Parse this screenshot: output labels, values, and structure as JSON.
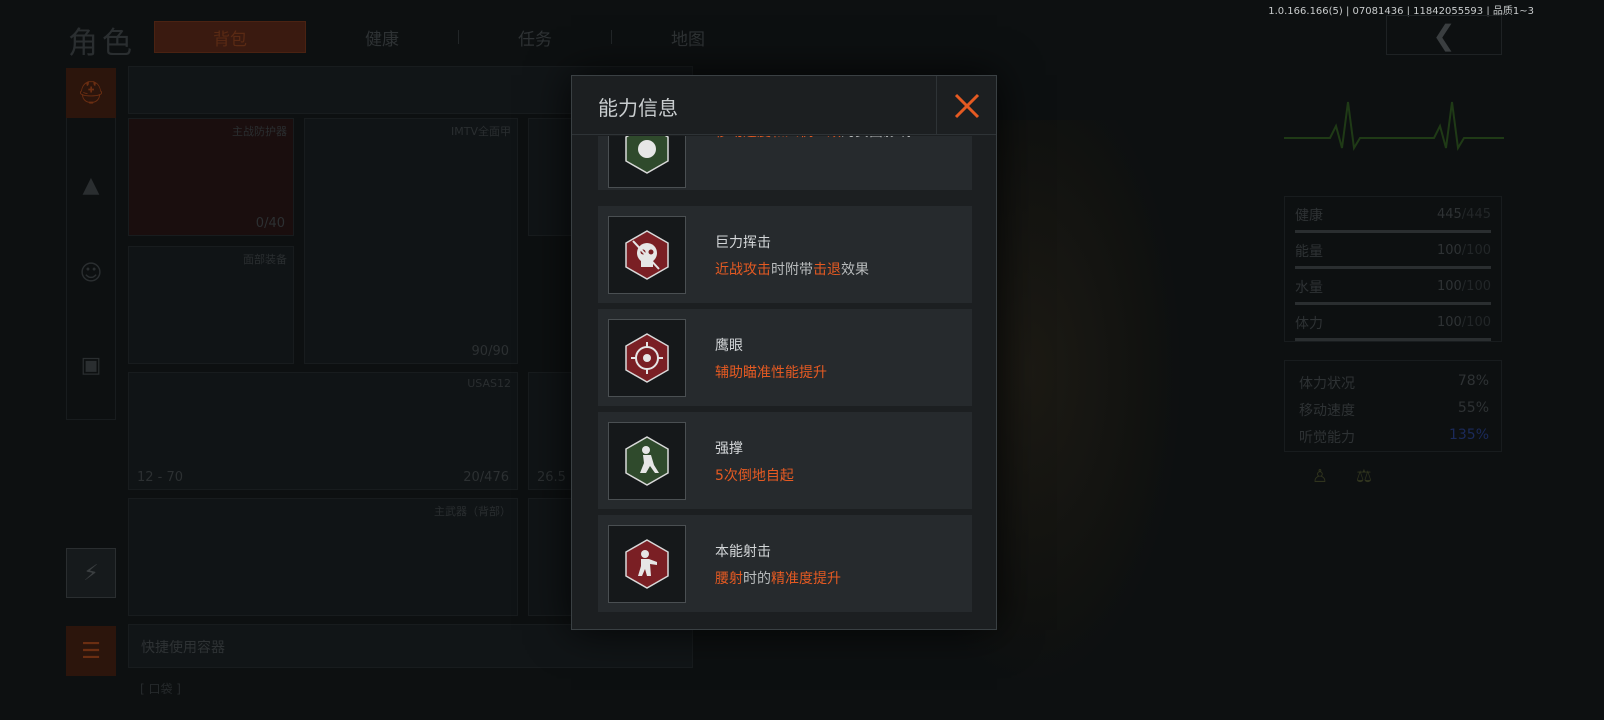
{
  "version": "1.0.166.166(5) | 07081436 | 11842055593 | 品质1~3",
  "page_title": "角色",
  "tabs": [
    {
      "label": "背包",
      "active": true
    },
    {
      "label": "健康",
      "active": false
    },
    {
      "label": "任务",
      "active": false
    },
    {
      "label": "地图",
      "active": false
    }
  ],
  "inventory": {
    "count": "4",
    "slots": {
      "armor_left_label": "主战防护器",
      "armor_left_value": "0/40",
      "vest_label": "IMTV全面甲",
      "vest_value": "90/90",
      "face_label": "面部装备",
      "gun_label": "USAS12",
      "gun_ammo": "12 - 70",
      "gun_value": "20/476",
      "slot_right_value": "26.5",
      "primary_label": "主武器（背部）"
    },
    "quick_use": "快捷使用容器",
    "pocket": "[ 口袋 ]"
  },
  "stats": [
    {
      "name": "健康",
      "value": "445",
      "max": "/445"
    },
    {
      "name": "能量",
      "value": "100",
      "max": "/100"
    },
    {
      "name": "水量",
      "value": "100",
      "max": "/100"
    },
    {
      "name": "体力",
      "value": "100",
      "max": "/100"
    }
  ],
  "status": [
    {
      "name": "体力状况",
      "value": "78%"
    },
    {
      "name": "移动速度",
      "value": "55%"
    },
    {
      "name": "听觉能力",
      "value": "135%"
    }
  ],
  "modal": {
    "title": "能力信息",
    "partial": {
      "parts": [
        {
          "t": "大幅",
          "h": true
        },
        {
          "t": "降低，",
          "h": false
        },
        {
          "t": "结构强度为强",
          "h": true
        },
        {
          "t": "的防具，造成的",
          "h": false
        },
        {
          "t": "移动速度和人机工效",
          "h": true
        },
        {
          "t": "的负面影响",
          "h": false
        }
      ]
    },
    "abilities": [
      {
        "name": "巨力挥击",
        "parts": [
          {
            "t": "近战攻击",
            "h": true
          },
          {
            "t": "时附带",
            "h": false
          },
          {
            "t": "击退",
            "h": true
          },
          {
            "t": "效果",
            "h": false
          }
        ],
        "color": "#7a1f24"
      },
      {
        "name": "鹰眼",
        "parts": [
          {
            "t": "辅助瞄准性能提升",
            "h": true
          }
        ],
        "color": "#7a1f24"
      },
      {
        "name": "强撑",
        "parts": [
          {
            "t": "5次倒地自起",
            "h": true
          }
        ],
        "color": "#2f4a2c"
      },
      {
        "name": "本能射击",
        "parts": [
          {
            "t": "腰射",
            "h": true
          },
          {
            "t": "时的",
            "h": false
          },
          {
            "t": "精准度提升",
            "h": true
          }
        ],
        "color": "#7a1f24"
      }
    ]
  },
  "colors": {
    "accent": "#e55a22",
    "modal_bg": "#1c1f21",
    "card_bg": "#262a2d",
    "title_text": "#c9cdcf"
  }
}
